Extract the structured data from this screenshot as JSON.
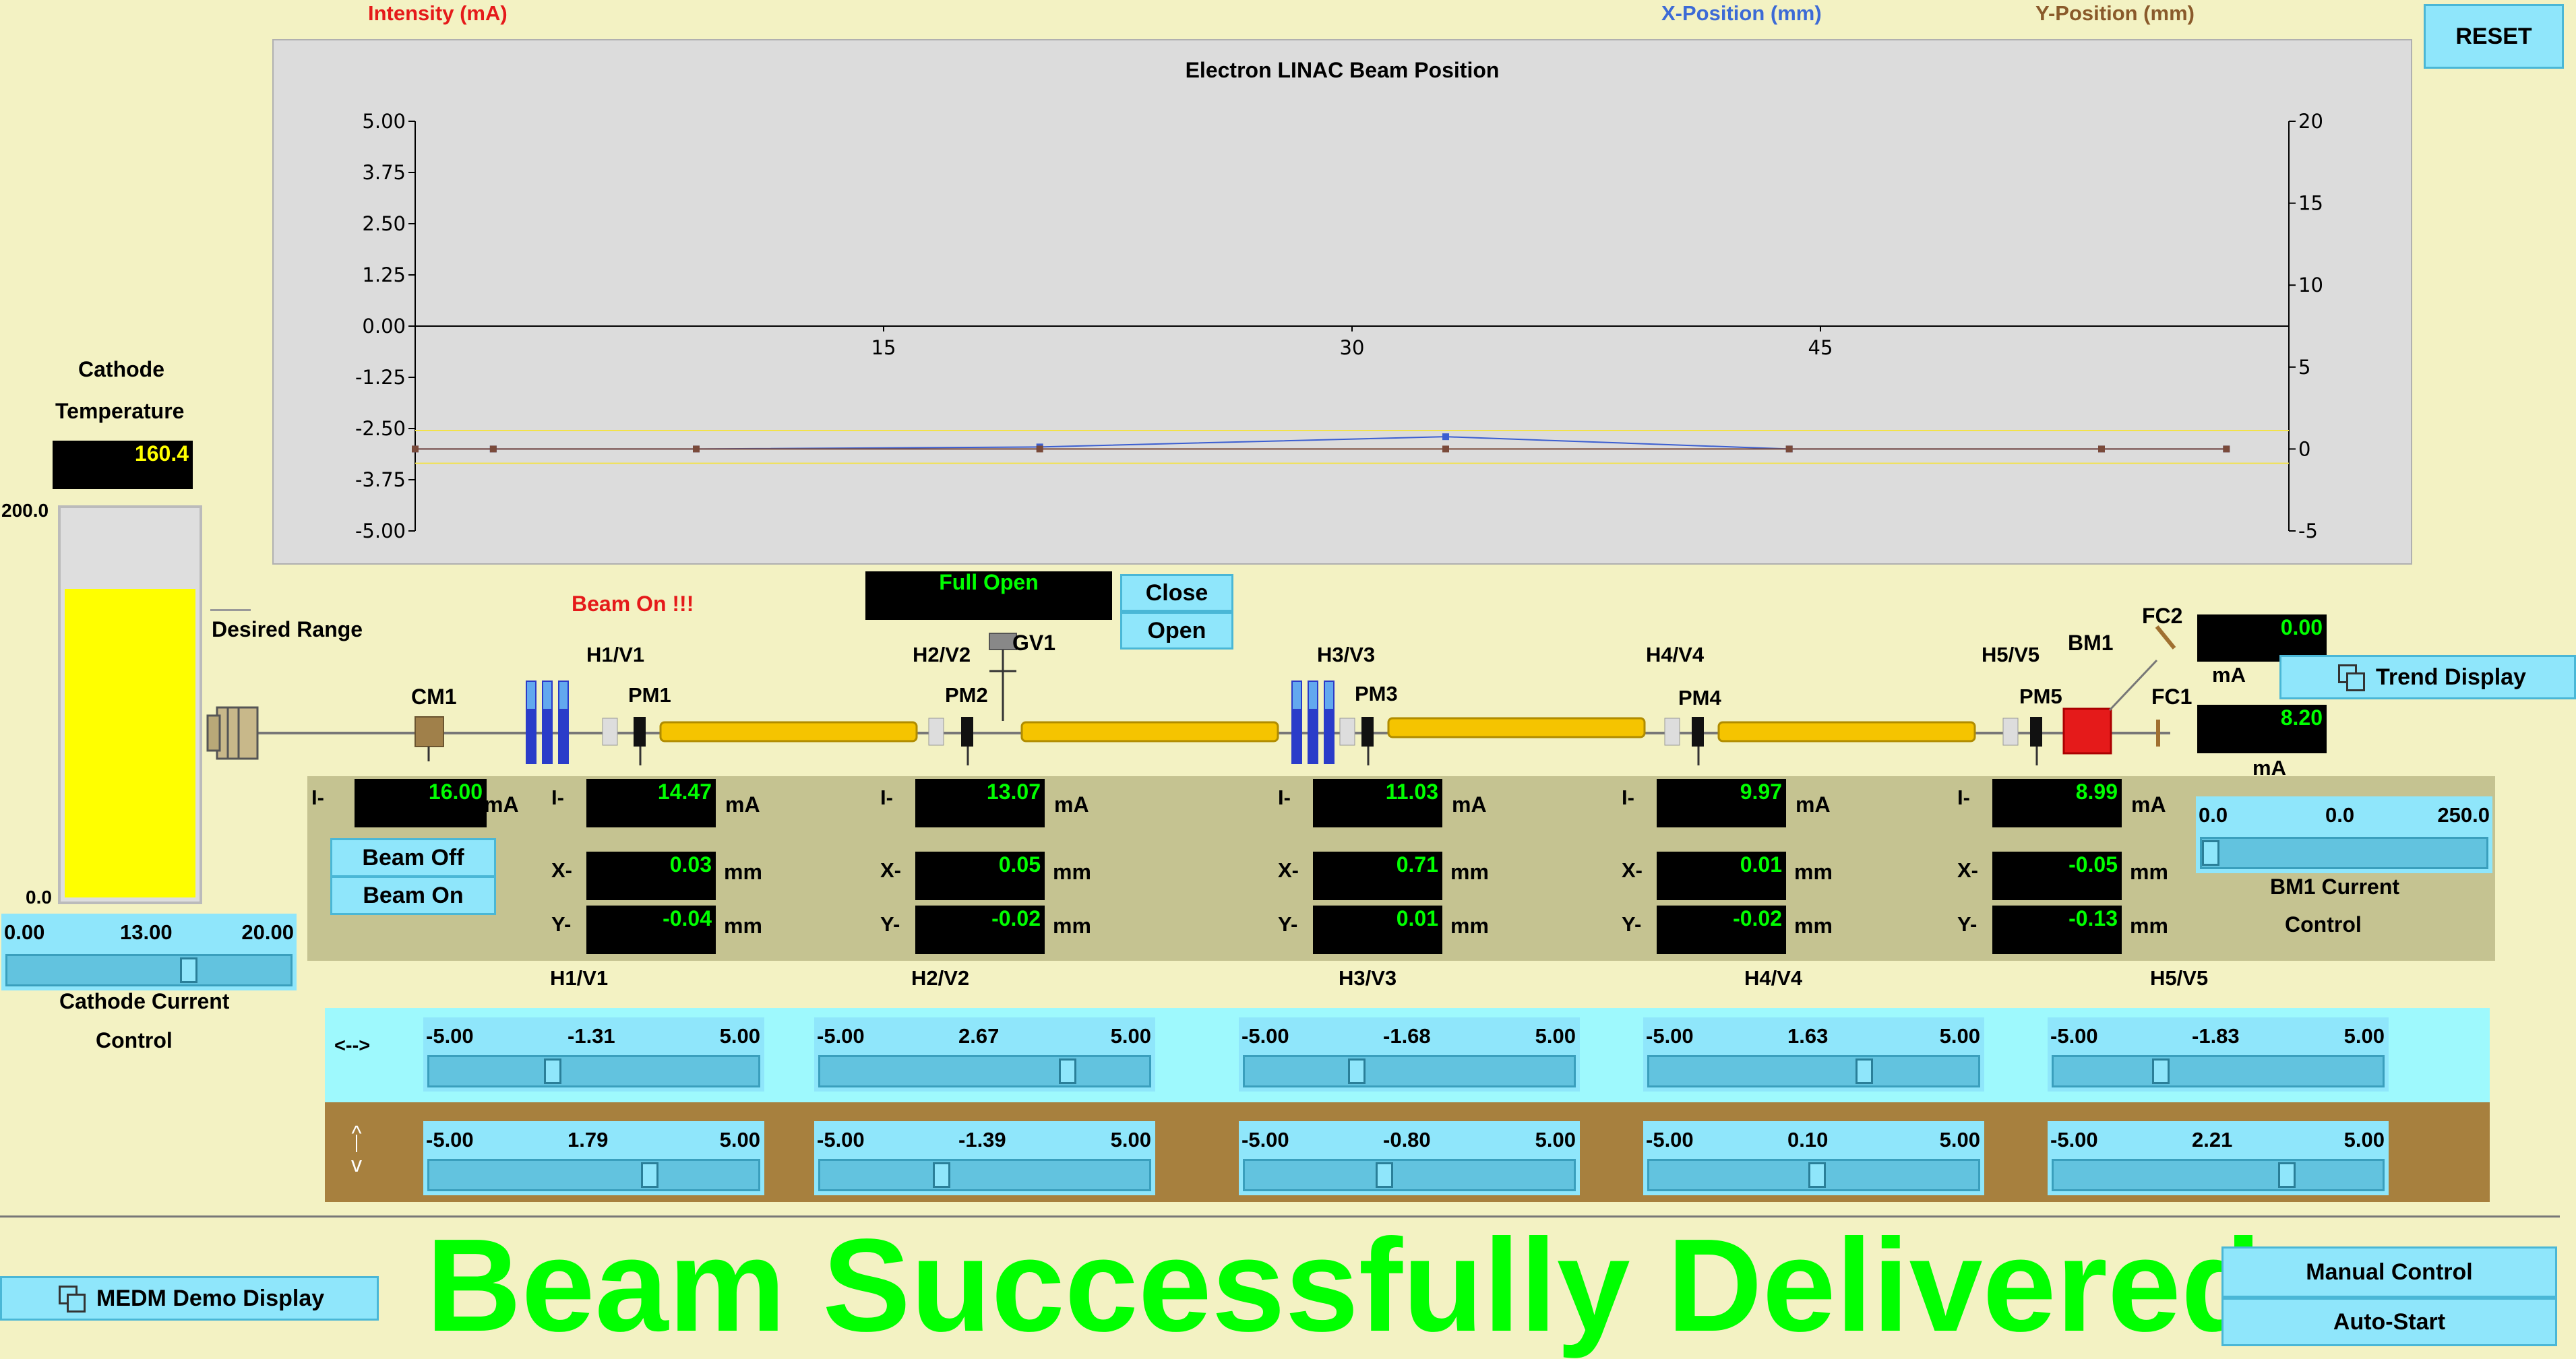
{
  "header": {
    "intensity_label": "Intensity (mA)",
    "xpos_label": "X-Position (mm)",
    "ypos_label": "Y-Position (mm)",
    "reset_label": "RESET"
  },
  "chart_data": {
    "type": "line",
    "title": "Electron LINAC Beam Position",
    "y_left_ticks": [
      "5.00",
      "3.75",
      "2.50",
      "1.25",
      "0.00",
      "-1.25",
      "-2.50",
      "-3.75",
      "-5.00"
    ],
    "y_left_range": [
      -5,
      5
    ],
    "y_right_ticks": [
      "20",
      "15",
      "10",
      "5",
      "0",
      "-5"
    ],
    "y_right_range": [
      -5,
      20
    ],
    "x_ticks": [
      "15",
      "30",
      "45"
    ],
    "x_range": [
      0,
      60
    ],
    "series": [
      {
        "color": "#3c5fd1",
        "x": [
          0,
          2.5,
          9,
          20,
          33,
          44,
          54,
          58
        ],
        "y": [
          -3.0,
          -3.0,
          -3.0,
          -2.95,
          -2.7,
          -3.0,
          -3.0,
          -3.0
        ]
      },
      {
        "color": "#7a4a3a",
        "x": [
          0,
          2.5,
          9,
          20,
          33,
          44,
          54,
          58
        ],
        "y": [
          -3.0,
          -3.0,
          -3.0,
          -3.0,
          -3.0,
          -3.0,
          -3.0,
          -3.0
        ]
      }
    ]
  },
  "cathode": {
    "title_line1": "Cathode",
    "title_line2": "Temperature",
    "temperature": "160.4",
    "bar_max": "200.0",
    "bar_min": "0.0",
    "bar_level": 0.8,
    "desired_range": "Desired Range",
    "slider_min": "0.00",
    "slider_value": "13.00",
    "slider_max": "20.00",
    "slider_level": 0.65,
    "control_line1": "Cathode Current",
    "control_line2": "Control"
  },
  "beamline": {
    "beam_on_status": "Beam On !!!",
    "cm1": "CM1",
    "gv1": "GV1",
    "gv_status": "Full Open",
    "close_label": "Close",
    "open_label": "Open",
    "bm1": "BM1",
    "fc1": "FC1",
    "fc2": "FC2",
    "fc2_value": "0.00",
    "fc1_value": "8.20",
    "unit_ma": "mA",
    "trend_label": "Trend Display",
    "stations": [
      {
        "hv": "H1/V1",
        "pm": "PM1"
      },
      {
        "hv": "H2/V2",
        "pm": "PM2"
      },
      {
        "hv": "H3/V3",
        "pm": "PM3"
      },
      {
        "hv": "H4/V4",
        "pm": "PM4"
      },
      {
        "hv": "H5/V5",
        "pm": "PM5"
      }
    ]
  },
  "readouts": {
    "cm1_current": "16.00",
    "i_label": "I-",
    "x_label": "X-",
    "y_label": "Y-",
    "unit_ma": "mA",
    "unit_mm": "mm",
    "beam_off": "Beam Off",
    "beam_on": "Beam On",
    "stations": [
      {
        "name": "H1/V1",
        "i": "14.47",
        "x": "0.03",
        "y": "-0.04"
      },
      {
        "name": "H2/V2",
        "i": "13.07",
        "x": "0.05",
        "y": "-0.02"
      },
      {
        "name": "H3/V3",
        "i": "11.03",
        "x": "0.71",
        "y": "0.01"
      },
      {
        "name": "H4/V4",
        "i": "9.97",
        "x": "0.01",
        "y": "-0.02"
      },
      {
        "name": "H5/V5",
        "i": "8.99",
        "x": "-0.05",
        "y": "-0.13"
      }
    ],
    "bm1_min": "0.0",
    "bm1_value": "0.0",
    "bm1_max": "250.0",
    "bm1_level": 0.0,
    "bm1_line1": "BM1 Current",
    "bm1_line2": "Control"
  },
  "steering": {
    "horiz_label": "<-->",
    "vert_up": "^",
    "vert_down": "v",
    "horiz": [
      {
        "min": "-5.00",
        "value": "-1.31",
        "max": "5.00",
        "level": 0.369
      },
      {
        "min": "-5.00",
        "value": "2.67",
        "max": "5.00",
        "level": 0.767
      },
      {
        "min": "-5.00",
        "value": "-1.68",
        "max": "5.00",
        "level": 0.332
      },
      {
        "min": "-5.00",
        "value": "1.63",
        "max": "5.00",
        "level": 0.663
      },
      {
        "min": "-5.00",
        "value": "-1.83",
        "max": "5.00",
        "level": 0.317
      }
    ],
    "vert": [
      {
        "min": "-5.00",
        "value": "1.79",
        "max": "5.00",
        "level": 0.679
      },
      {
        "min": "-5.00",
        "value": "-1.39",
        "max": "5.00",
        "level": 0.361
      },
      {
        "min": "-5.00",
        "value": "-0.80",
        "max": "5.00",
        "level": 0.42
      },
      {
        "min": "-5.00",
        "value": "0.10",
        "max": "5.00",
        "level": 0.51
      },
      {
        "min": "-5.00",
        "value": "2.21",
        "max": "5.00",
        "level": 0.721
      }
    ]
  },
  "footer": {
    "medm_label": "MEDM Demo Display",
    "status_message": "Beam Successfully Delivered",
    "manual_label": "Manual Control",
    "autostart_label": "Auto-Start"
  },
  "colors": {
    "background": "#f3f2c3",
    "panel": "#c5c391",
    "button": "#8fe6fb",
    "meter_text": "#00ff00",
    "status_green": "#00ff00",
    "alarm_red": "#e51a1a",
    "steer_vert_bg": "#a7803e"
  }
}
